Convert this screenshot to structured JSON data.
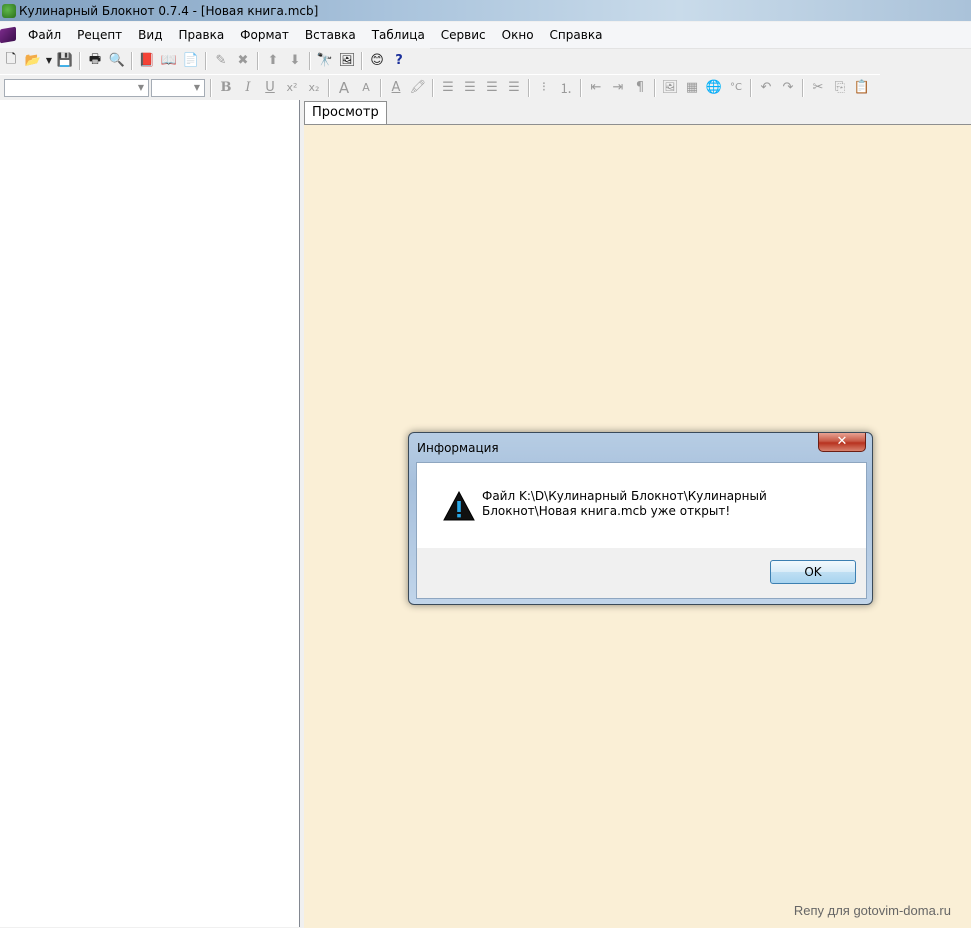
{
  "window": {
    "title": "Кулинарный Блокнот 0.7.4 - [Новая книга.mcb]"
  },
  "menu": {
    "items": [
      "Файл",
      "Рецепт",
      "Вид",
      "Правка",
      "Формат",
      "Вставка",
      "Таблица",
      "Сервис",
      "Окно",
      "Справка"
    ]
  },
  "font_combo": {
    "value": ""
  },
  "size_combo": {
    "value": ""
  },
  "tabs": {
    "preview_label": "Просмотр"
  },
  "preview": {
    "background": "#faefd6"
  },
  "watermark": {
    "text": "Reпу для gotovim-doma.ru"
  },
  "dialog": {
    "title": "Информация",
    "message": "Файл K:\\D\\Кулинарный Блокнот\\Кулинарный Блокнот\\Новая книга.mcb уже открыт!",
    "ok_label": "OK",
    "close_glyph": "✕"
  }
}
